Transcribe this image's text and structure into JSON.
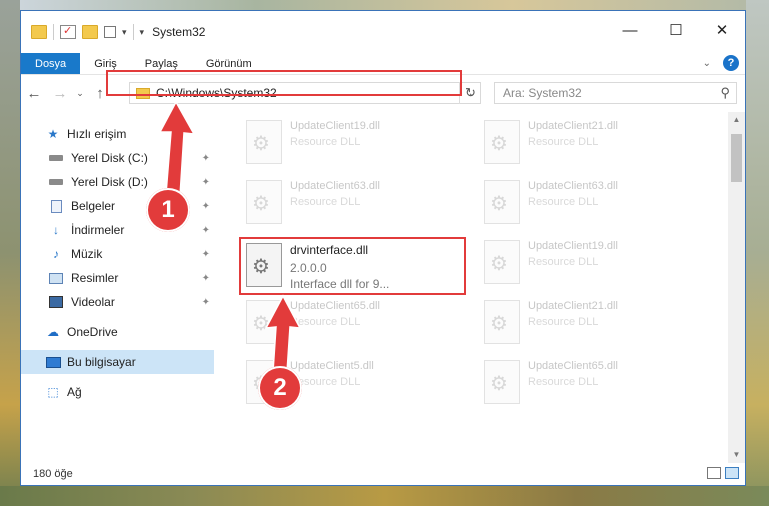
{
  "window": {
    "title": "System32",
    "minimize_label": "—",
    "maximize_label": "☐",
    "close_label": "✕"
  },
  "ribbon": {
    "tabs": [
      {
        "label": "Dosya",
        "active": true
      },
      {
        "label": "Giriş"
      },
      {
        "label": "Paylaş"
      },
      {
        "label": "Görünüm"
      }
    ],
    "help_label": "?"
  },
  "navigation": {
    "back": "←",
    "forward": "→",
    "recent": "⌄",
    "up": "↑",
    "address": "C:\\Windows\\System32",
    "refresh": "↻",
    "search_placeholder": "Ara: System32"
  },
  "sidebar": {
    "items": [
      {
        "label": "Hızlı erişim",
        "icon": "star-icon"
      },
      {
        "label": "Yerel Disk (C:)",
        "icon": "disk-icon",
        "pinned": true
      },
      {
        "label": "Yerel Disk (D:)",
        "icon": "disk-icon",
        "pinned": true
      },
      {
        "label": "Belgeler",
        "icon": "document-icon",
        "pinned": true
      },
      {
        "label": "İndirmeler",
        "icon": "download-icon",
        "pinned": true
      },
      {
        "label": "Müzik",
        "icon": "music-icon",
        "pinned": true
      },
      {
        "label": "Resimler",
        "icon": "pictures-icon",
        "pinned": true
      },
      {
        "label": "Videolar",
        "icon": "video-icon",
        "pinned": true
      },
      {
        "label": "OneDrive",
        "icon": "cloud-icon"
      },
      {
        "label": "Bu bilgisayar",
        "icon": "computer-icon",
        "selected": true
      },
      {
        "label": "Ağ",
        "icon": "network-icon"
      }
    ]
  },
  "files": {
    "faded": [
      {
        "name": "UpdateClient19.dll",
        "desc": "Resource DLL"
      },
      {
        "name": "UpdateClient21.dll",
        "desc": "Resource DLL"
      },
      {
        "name": "UpdateClient63.dll",
        "desc": "Resource DLL"
      },
      {
        "name": "UpdateClient63.dll",
        "desc": "Resource DLL"
      },
      {
        "name": "UpdateClient19.dll",
        "desc": "Resource DLL"
      },
      {
        "name": "UpdateClient65.dll",
        "desc": "Resource DLL"
      },
      {
        "name": "UpdateClient21.dll",
        "desc": "Resource DLL"
      },
      {
        "name": "UpdateClient5.dll",
        "desc": "Resource DLL"
      },
      {
        "name": "UpdateClient65.dll",
        "desc": "Resource DLL"
      }
    ],
    "selected": {
      "name": "drvinterface.dll",
      "version": "2.0.0.0",
      "desc": "Interface dll for 9..."
    }
  },
  "status": {
    "item_count": "180 öğe"
  },
  "annotations": {
    "step1": "1",
    "step2": "2",
    "highlight_color": "#e23b3b"
  }
}
